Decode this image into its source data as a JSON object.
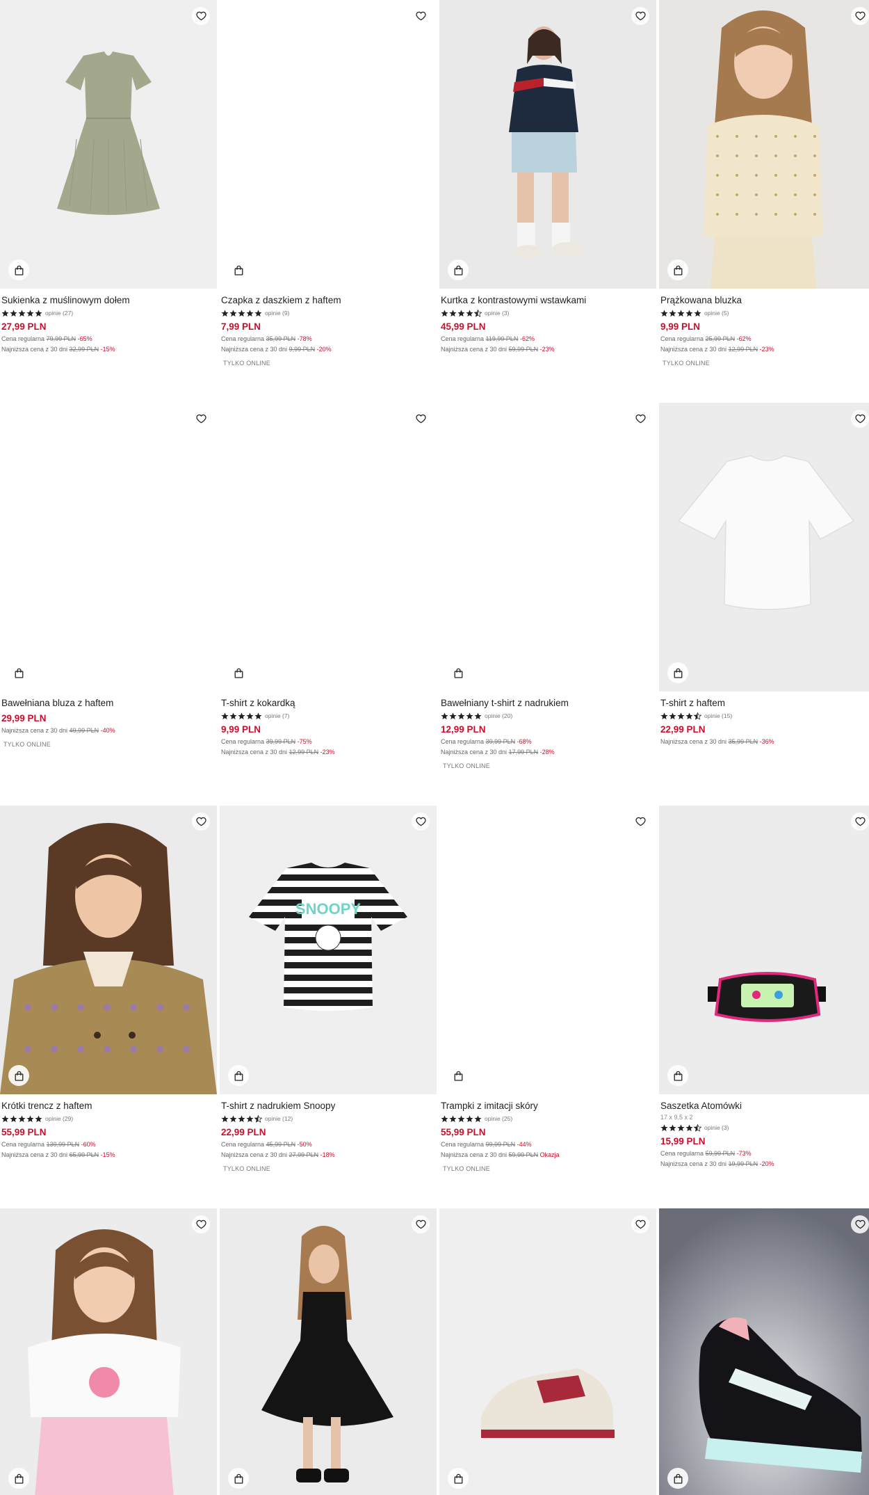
{
  "labels": {
    "regular": "Cena regularna",
    "lowest30": "Najniższa cena z 30 dni",
    "online_only": "TYLKO ONLINE"
  },
  "products": [
    {
      "name": "Sukienka z muślinowym dołem",
      "stars": 5,
      "reviews": "opinie (27)",
      "price": "27,99 PLN",
      "regular_old": "79,99 PLN",
      "regular_disc": "-65%",
      "lowest_old": "32,99 PLN",
      "lowest_disc": "-15%",
      "online": false,
      "image": "olive-dress"
    },
    {
      "name": "Czapka z daszkiem z haftem",
      "stars": 5,
      "reviews": "opinie (9)",
      "price": "7,99 PLN",
      "regular_old": "35,99 PLN",
      "regular_disc": "-78%",
      "lowest_old": "9,99 PLN",
      "lowest_disc": "-20%",
      "online": true,
      "image": "blank"
    },
    {
      "name": "Kurtka z kontrastowymi wstawkami",
      "stars": 4.5,
      "reviews": "opinie (3)",
      "price": "45,99 PLN",
      "regular_old": "119,99 PLN",
      "regular_disc": "-62%",
      "lowest_old": "59,99 PLN",
      "lowest_disc": "-23%",
      "online": false,
      "image": "girl-jacket"
    },
    {
      "name": "Prążkowana bluzka",
      "stars": 5,
      "reviews": "opinie (5)",
      "price": "9,99 PLN",
      "regular_old": "25,99 PLN",
      "regular_disc": "-62%",
      "lowest_old": "12,99 PLN",
      "lowest_disc": "-23%",
      "online": true,
      "image": "girl-cream"
    },
    {
      "name": "Bawełniana bluza z haftem",
      "stars": 0,
      "reviews": "",
      "price": "29,99 PLN",
      "lowest_old": "49,99 PLN",
      "lowest_disc": "-40%",
      "online": true,
      "image": "blank"
    },
    {
      "name": "T-shirt z kokardką",
      "stars": 5,
      "reviews": "opinie (7)",
      "price": "9,99 PLN",
      "regular_old": "39,99 PLN",
      "regular_disc": "-75%",
      "lowest_old": "12,99 PLN",
      "lowest_disc": "-23%",
      "online": false,
      "image": "blank"
    },
    {
      "name": "Bawełniany t-shirt z nadrukiem",
      "stars": 5,
      "reviews": "opinie (20)",
      "price": "12,99 PLN",
      "regular_old": "39,99 PLN",
      "regular_disc": "-68%",
      "lowest_old": "17,99 PLN",
      "lowest_disc": "-28%",
      "online": true,
      "image": "blank"
    },
    {
      "name": "T-shirt z haftem",
      "stars": 4.5,
      "reviews": "opinie (15)",
      "price": "22,99 PLN",
      "lowest_old": "35,99 PLN",
      "lowest_disc": "-36%",
      "online": false,
      "image": "white-tee"
    },
    {
      "name": "Krótki trencz z haftem",
      "stars": 5,
      "reviews": "opinie (29)",
      "price": "55,99 PLN",
      "regular_old": "139,99 PLN",
      "regular_disc": "-60%",
      "lowest_old": "65,99 PLN",
      "lowest_disc": "-15%",
      "online": false,
      "image": "girl-trench"
    },
    {
      "name": "T-shirt z nadrukiem Snoopy",
      "stars": 4.5,
      "reviews": "opinie (12)",
      "price": "22,99 PLN",
      "regular_old": "45,99 PLN",
      "regular_disc": "-50%",
      "lowest_old": "27,99 PLN",
      "lowest_disc": "-18%",
      "online": true,
      "image": "striped-tee"
    },
    {
      "name": "Trampki z imitacji skóry",
      "stars": 5,
      "reviews": "opinie (25)",
      "price": "55,99 PLN",
      "regular_old": "99,99 PLN",
      "regular_disc": "-44%",
      "lowest_old": "59,99 PLN",
      "lowest_disc": "Okazja",
      "online": true,
      "image": "blank"
    },
    {
      "name": "Saszetka Atomówki",
      "size": "17 x 9,5 x 2",
      "stars": 4.5,
      "reviews": "opinie (3)",
      "price": "15,99 PLN",
      "regular_old": "59,99 PLN",
      "regular_disc": "-73%",
      "lowest_old": "19,99 PLN",
      "lowest_disc": "-20%",
      "online": false,
      "image": "bag"
    },
    {
      "name": "",
      "image": "girl-crab"
    },
    {
      "name": "",
      "image": "girl-black-dress"
    },
    {
      "name": "",
      "image": "sneakers-white"
    },
    {
      "name": "",
      "image": "sneakers-black"
    }
  ],
  "colors": {
    "accent": "#c8102e",
    "text": "#222222",
    "muted": "#777777"
  }
}
